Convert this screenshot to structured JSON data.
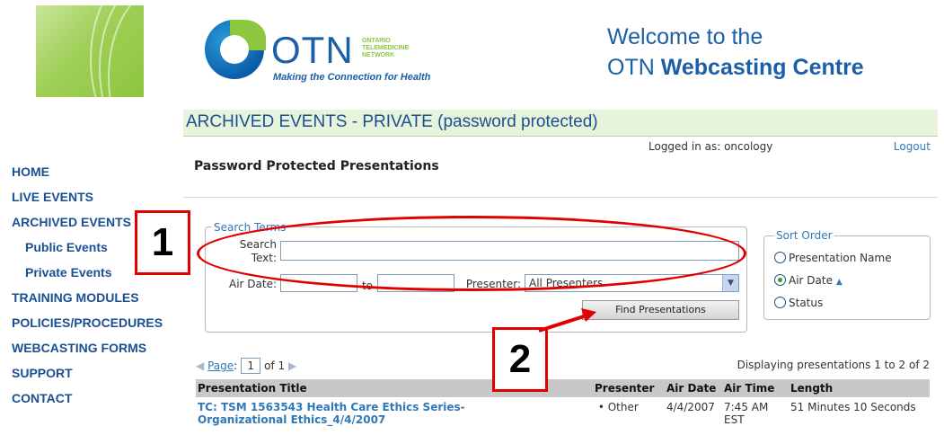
{
  "header": {
    "logo_word": "OTN",
    "logo_org": "ONTARIO TELEMEDICINE NETWORK",
    "logo_tagline": "Making the Connection for Health",
    "welcome_line1": "Welcome to the",
    "welcome_line2_prefix": "OTN",
    "welcome_line2_bold": "Webcasting Centre"
  },
  "section_title": "ARCHIVED EVENTS - PRIVATE (password protected)",
  "nav": {
    "items": [
      {
        "label": "HOME"
      },
      {
        "label": "LIVE EVENTS"
      },
      {
        "label": "ARCHIVED EVENTS"
      },
      {
        "label": "Public Events"
      },
      {
        "label": "Private Events"
      },
      {
        "label": "TRAINING MODULES"
      },
      {
        "label": "POLICIES/PROCEDURES"
      },
      {
        "label": "WEBCASTING FORMS"
      },
      {
        "label": "SUPPORT"
      },
      {
        "label": "CONTACT"
      }
    ]
  },
  "session": {
    "logged_in": "Logged in as: oncology",
    "logout": "Logout"
  },
  "page_title": "Password Protected Presentations",
  "search": {
    "legend": "Search Terms",
    "search_label_1": "Search",
    "search_label_2": "Text:",
    "air_date_label": "Air Date:",
    "to_label": "to",
    "presenter_label": "Presenter:",
    "presenter_value": "All Presenters",
    "find_button": "Find Presentations"
  },
  "sort": {
    "legend": "Sort Order",
    "options": [
      {
        "label": "Presentation Name",
        "selected": false
      },
      {
        "label": "Air Date",
        "selected": true
      },
      {
        "label": "Status",
        "selected": false
      }
    ]
  },
  "pager": {
    "page_label": "Page",
    "page_value": "1",
    "of_label": "of 1",
    "displaying": "Displaying presentations 1 to 2 of 2"
  },
  "table": {
    "headers": [
      "Presentation Title",
      "Presenter",
      "Air Date",
      "Air Time",
      "Length"
    ],
    "rows": [
      {
        "title_line1": "TC: TSM 1563543 Health Care Ethics Series-",
        "title_line2": "Organizational Ethics_4/4/2007",
        "presenter": "Other",
        "air_date": "4/4/2007",
        "air_time_1": "7:45 AM",
        "air_time_2": "EST",
        "length": "51 Minutes 10 Seconds"
      }
    ]
  },
  "callouts": {
    "one": "1",
    "two": "2",
    "color": "#e00000"
  }
}
